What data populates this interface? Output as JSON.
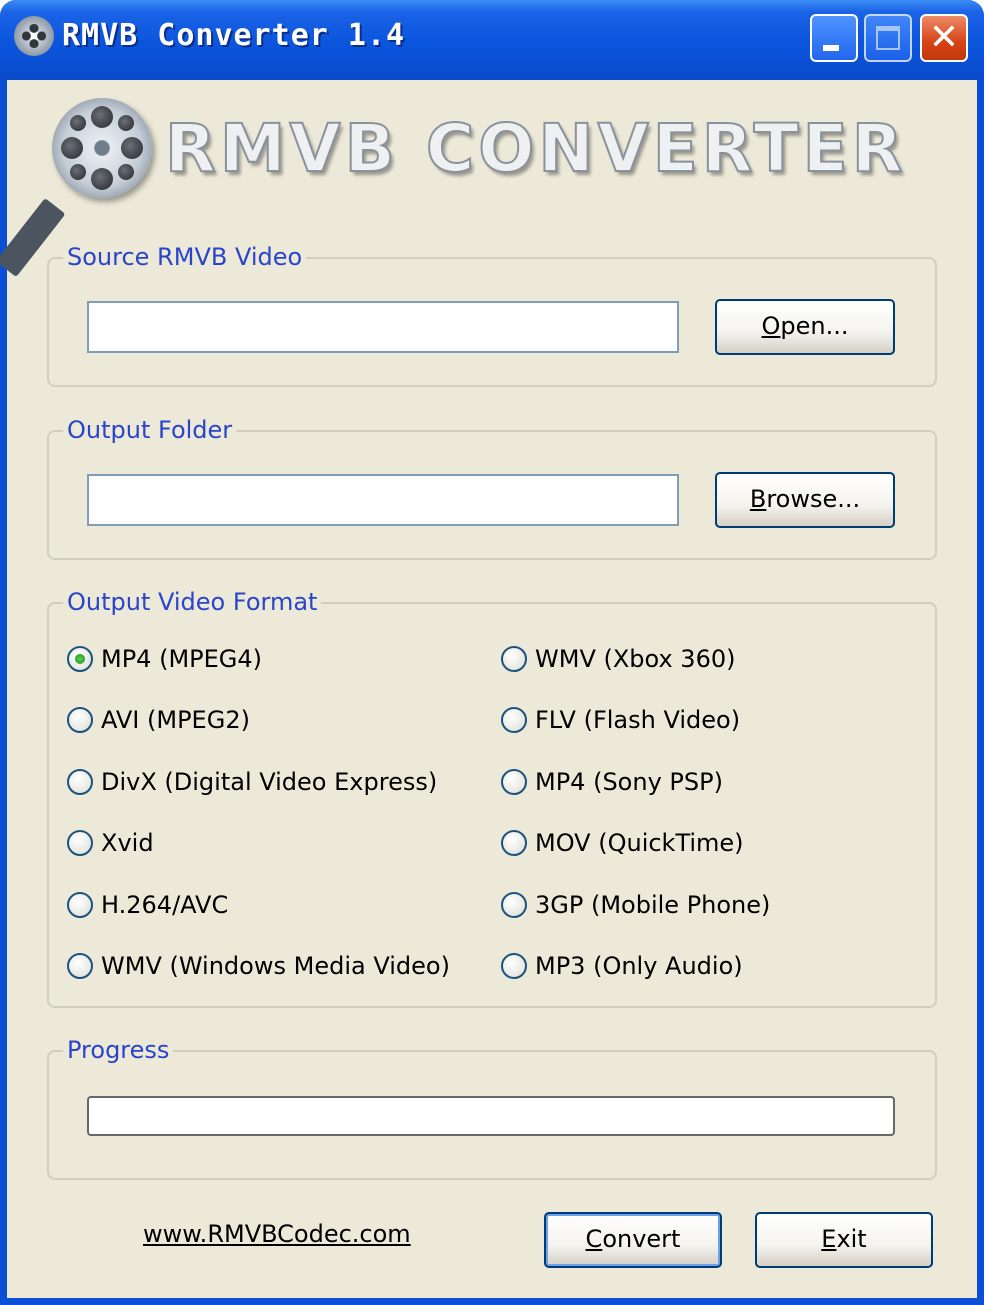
{
  "window": {
    "title": "RMVB Converter 1.4",
    "close_glyph": "✕"
  },
  "logo": {
    "text": "RMVB CONVERTER"
  },
  "source": {
    "legend": "Source RMVB Video",
    "value": "",
    "open_label_mnemonic": "O",
    "open_label_rest": "pen..."
  },
  "output_folder": {
    "legend": "Output Folder",
    "value": "",
    "browse_label_mnemonic": "B",
    "browse_label_rest": "rowse..."
  },
  "format": {
    "legend": "Output Video Format",
    "selected": "MP4 (MPEG4)",
    "left_options": [
      "MP4 (MPEG4)",
      "AVI (MPEG2)",
      "DivX (Digital Video Express)",
      "Xvid",
      "H.264/AVC",
      "WMV (Windows Media Video)"
    ],
    "right_options": [
      "WMV (Xbox 360)",
      "FLV (Flash Video)",
      "MP4 (Sony PSP)",
      "MOV (QuickTime)",
      "3GP (Mobile Phone)",
      "MP3 (Only Audio)"
    ]
  },
  "progress": {
    "legend": "Progress",
    "value": 0
  },
  "footer": {
    "website": "www.RMVBCodec.com",
    "convert_label_mnemonic": "C",
    "convert_label_rest": "onvert",
    "exit_label_mnemonic": "E",
    "exit_label_rest": "xit"
  },
  "colors": {
    "titlebar": "#0a4fd6",
    "dialog_bg": "#ece9d8",
    "legend_text": "#2a45c9",
    "radio_checked": "#218a1c"
  }
}
